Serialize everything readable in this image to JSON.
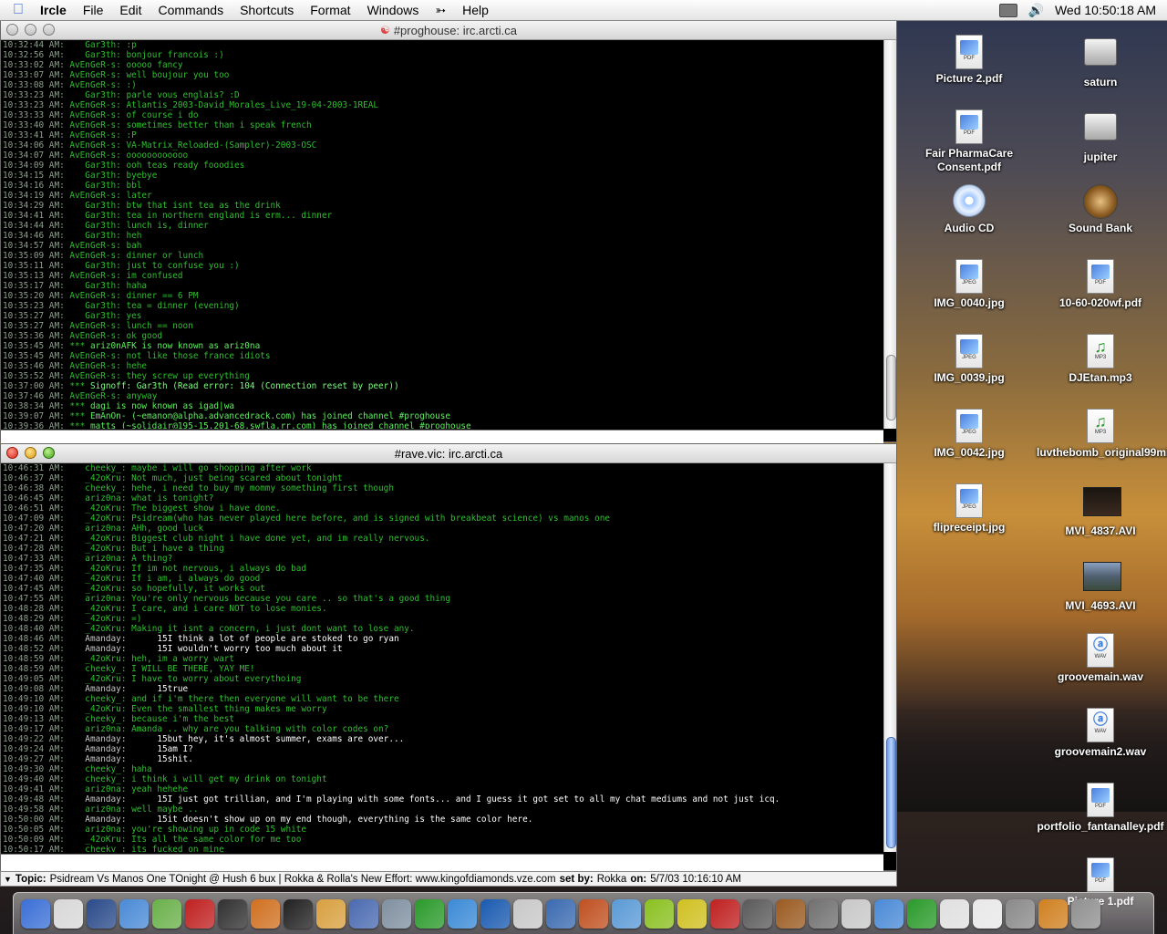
{
  "menubar": {
    "app": "Ircle",
    "items": [
      "File",
      "Edit",
      "Commands",
      "Shortcuts",
      "Format",
      "Windows",
      "Help"
    ],
    "clock": "Wed 10:50:18 AM"
  },
  "win1": {
    "title": "#proghouse: irc.arcti.ca",
    "lines": [
      {
        "t": "10:32:44 AM:",
        "n": "   Gar3th:",
        "m": " :p"
      },
      {
        "t": "10:32:56 AM:",
        "n": "   Gar3th:",
        "m": " bonjour francois :)"
      },
      {
        "t": "10:33:02 AM:",
        "n": "AvEnGeR-s:",
        "m": " ooooo fancy"
      },
      {
        "t": "10:33:07 AM:",
        "n": "AvEnGeR-s:",
        "m": " well boujour you too"
      },
      {
        "t": "10:33:08 AM:",
        "n": "AvEnGeR-s:",
        "m": " :)"
      },
      {
        "t": "10:33:23 AM:",
        "n": "   Gar3th:",
        "m": " parle vous englais? :D"
      },
      {
        "t": "10:33:23 AM:",
        "n": "AvEnGeR-s:",
        "m": " Atlantis_2003-David_Morales_Live_19-04-2003-1REAL"
      },
      {
        "t": "10:33:33 AM:",
        "n": "AvEnGeR-s:",
        "m": " of course i do"
      },
      {
        "t": "10:33:40 AM:",
        "n": "AvEnGeR-s:",
        "m": " sometimes better than i speak french"
      },
      {
        "t": "10:33:41 AM:",
        "n": "AvEnGeR-s:",
        "m": " :P"
      },
      {
        "t": "10:34:06 AM:",
        "n": "AvEnGeR-s:",
        "m": " VA-Matrix_Reloaded-(Sampler)-2003-OSC"
      },
      {
        "t": "10:34:07 AM:",
        "n": "AvEnGeR-s:",
        "m": " oooooooooooo"
      },
      {
        "t": "10:34:09 AM:",
        "n": "   Gar3th:",
        "m": " ooh teas ready fooodies"
      },
      {
        "t": "10:34:15 AM:",
        "n": "   Gar3th:",
        "m": " byebye"
      },
      {
        "t": "10:34:16 AM:",
        "n": "   Gar3th:",
        "m": " bbl"
      },
      {
        "t": "10:34:19 AM:",
        "n": "AvEnGeR-s:",
        "m": " later"
      },
      {
        "t": "10:34:29 AM:",
        "n": "   Gar3th:",
        "m": " btw that isnt tea as the drink"
      },
      {
        "t": "10:34:41 AM:",
        "n": "   Gar3th:",
        "m": " tea in northern england is erm... dinner"
      },
      {
        "t": "10:34:44 AM:",
        "n": "   Gar3th:",
        "m": " lunch is, dinner"
      },
      {
        "t": "10:34:46 AM:",
        "n": "   Gar3th:",
        "m": " heh"
      },
      {
        "t": "10:34:57 AM:",
        "n": "AvEnGeR-s:",
        "m": " bah"
      },
      {
        "t": "10:35:09 AM:",
        "n": "AvEnGeR-s:",
        "m": " dinner or lunch"
      },
      {
        "t": "10:35:11 AM:",
        "n": "   Gar3th:",
        "m": " just to confuse you :)"
      },
      {
        "t": "10:35:13 AM:",
        "n": "AvEnGeR-s:",
        "m": " im confused"
      },
      {
        "t": "10:35:17 AM:",
        "n": "   Gar3th:",
        "m": " haha"
      },
      {
        "t": "10:35:20 AM:",
        "n": "AvEnGeR-s:",
        "m": " dinner == 6 PM"
      },
      {
        "t": "10:35:23 AM:",
        "n": "   Gar3th:",
        "m": " tea = dinner (evening)"
      },
      {
        "t": "10:35:27 AM:",
        "n": "   Gar3th:",
        "m": " yes"
      },
      {
        "t": "10:35:27 AM:",
        "n": "AvEnGeR-s:",
        "m": " lunch == noon"
      },
      {
        "t": "10:35:36 AM:",
        "n": "AvEnGeR-s:",
        "m": " ok good"
      },
      {
        "t": "10:35:45 AM:",
        "n": "***",
        "m": " ariz0nAFK is now known as ariz0na",
        "k": "sys"
      },
      {
        "t": "10:35:45 AM:",
        "n": "AvEnGeR-s:",
        "m": " not like those france idiots"
      },
      {
        "t": "10:35:46 AM:",
        "n": "AvEnGeR-s:",
        "m": " hehe"
      },
      {
        "t": "10:35:52 AM:",
        "n": "AvEnGeR-s:",
        "m": " they screw up everything"
      },
      {
        "t": "10:37:00 AM:",
        "n": "***",
        "m": " Signoff: Gar3th (Read error: 104 (Connection reset by peer))",
        "k": "err"
      },
      {
        "t": "10:37:46 AM:",
        "n": "AvEnGeR-s:",
        "m": " anyway"
      },
      {
        "t": "10:38:34 AM:",
        "n": "***",
        "m": " dagi is now known as igad|wa",
        "k": "sys"
      },
      {
        "t": "10:39:07 AM:",
        "n": "***",
        "m": " EmAnOn- (~emanon@alpha.advancedrack.com) has joined channel #proghouse",
        "k": "sys"
      },
      {
        "t": "10:39:36 AM:",
        "n": "***",
        "m": " matts (~solidair@195-15.201-68.swfla.rr.com) has joined channel #proghouse",
        "k": "sys"
      }
    ]
  },
  "win2": {
    "title": "#rave.vic: irc.arcti.ca",
    "lines": [
      {
        "t": "10:46:31 AM:",
        "n": "   cheeky_:",
        "m": " maybe i will go shopping after work"
      },
      {
        "t": "10:46:37 AM:",
        "n": "   _42oKru:",
        "m": " Not much, just being scared about tonight"
      },
      {
        "t": "10:46:38 AM:",
        "n": "   cheeky_:",
        "m": " hehe, i need to buy my mommy something first though"
      },
      {
        "t": "10:46:45 AM:",
        "n": "   ariz0na:",
        "m": " what is tonight?"
      },
      {
        "t": "10:46:51 AM:",
        "n": "   _42oKru:",
        "m": " The biggest show i have done."
      },
      {
        "t": "10:47:09 AM:",
        "n": "   _42oKru:",
        "m": " Psidream(who has never played here before, and is signed with breakbeat science) vs manos one"
      },
      {
        "t": "10:47:20 AM:",
        "n": "   ariz0na:",
        "m": " AHh, good luck"
      },
      {
        "t": "10:47:21 AM:",
        "n": "   _42oKru:",
        "m": " Biggest club night i have done yet, and im really nervous."
      },
      {
        "t": "10:47:28 AM:",
        "n": "   _42oKru:",
        "m": " But i have a thing"
      },
      {
        "t": "10:47:33 AM:",
        "n": "   ariz0na:",
        "m": " A thing?"
      },
      {
        "t": "10:47:35 AM:",
        "n": "   _42oKru:",
        "m": " If im not nervous, i always do bad"
      },
      {
        "t": "10:47:40 AM:",
        "n": "   _42oKru:",
        "m": " If i am, i always do good"
      },
      {
        "t": "10:47:45 AM:",
        "n": "   _42oKru:",
        "m": " so hopefully, it works out"
      },
      {
        "t": "10:47:55 AM:",
        "n": "   ariz0na:",
        "m": " You're only nervous because you care .. so that's a good thing"
      },
      {
        "t": "10:48:28 AM:",
        "n": "   _42oKru:",
        "m": " I care, and i care NOT to lose monies."
      },
      {
        "t": "10:48:29 AM:",
        "n": "   _42oKru:",
        "m": " =)"
      },
      {
        "t": "10:48:40 AM:",
        "n": "   _42oKru:",
        "m": " Making it isnt a concern, i just dont want to lose any."
      },
      {
        "t": "10:48:46 AM:",
        "n": "   Amanday:",
        "m": "      15I think a lot of people are stoked to go ryan",
        "k": "me"
      },
      {
        "t": "10:48:52 AM:",
        "n": "   Amanday:",
        "m": "      15I wouldn't worry too much about it",
        "k": "me"
      },
      {
        "t": "10:48:59 AM:",
        "n": "   _42oKru:",
        "m": " heh, im a worry wart"
      },
      {
        "t": "10:48:59 AM:",
        "n": "   cheeky_:",
        "m": " I WILL BE THERE, YAY ME!"
      },
      {
        "t": "10:49:05 AM:",
        "n": "   _42oKru:",
        "m": " I have to worry about everythoing"
      },
      {
        "t": "10:49:08 AM:",
        "n": "   Amanday:",
        "m": "      15true",
        "k": "me"
      },
      {
        "t": "10:49:10 AM:",
        "n": "   cheeky_:",
        "m": " and if i'm there then everyone will want to be there"
      },
      {
        "t": "10:49:10 AM:",
        "n": "   _42oKru:",
        "m": " Even the smallest thing makes me worry"
      },
      {
        "t": "10:49:13 AM:",
        "n": "   cheeky_:",
        "m": " because i'm the best"
      },
      {
        "t": "10:49:17 AM:",
        "n": "   ariz0na:",
        "m": " Amanda .. why are you talking with color codes on?"
      },
      {
        "t": "10:49:22 AM:",
        "n": "   Amanday:",
        "m": "      15but hey, it's almost summer, exams are over...",
        "k": "me"
      },
      {
        "t": "10:49:24 AM:",
        "n": "   Amanday:",
        "m": "      15am I?",
        "k": "me"
      },
      {
        "t": "10:49:27 AM:",
        "n": "   Amanday:",
        "m": "      15shit.",
        "k": "me"
      },
      {
        "t": "10:49:30 AM:",
        "n": "   cheeky_:",
        "m": " haha"
      },
      {
        "t": "10:49:40 AM:",
        "n": "   cheeky_:",
        "m": " i think i will get my drink on tonight"
      },
      {
        "t": "10:49:41 AM:",
        "n": "   ariz0na:",
        "m": " yeah hehehe"
      },
      {
        "t": "10:49:48 AM:",
        "n": "   Amanday:",
        "m": "      15I just got trillian, and I'm playing with some fonts... and I guess it got set to all my chat mediums and not just icq.",
        "k": "me"
      },
      {
        "t": "10:49:58 AM:",
        "n": "   ariz0na:",
        "m": " well maybe .."
      },
      {
        "t": "10:50:00 AM:",
        "n": "   Amanday:",
        "m": "      15it doesn't show up on my end though, everything is the same color here.",
        "k": "me"
      },
      {
        "t": "10:50:05 AM:",
        "n": "   ariz0na:",
        "m": " you're showing up in code 15 white"
      },
      {
        "t": "10:50:09 AM:",
        "n": "   _42oKru:",
        "m": " Its all the same color for me too"
      },
      {
        "t": "10:50:17 AM:",
        "n": "   cheeky_:",
        "m": " its fucked on mine"
      }
    ]
  },
  "topic": {
    "label": "Topic:",
    "text": "Psidream Vs Manos One TOnight @ Hush 6 bux | Rokka & Rolla's New Effort: www.kingofdiamonds.vze.com",
    "setby_label": "set by:",
    "setby": "Rokka",
    "on_label": "on:",
    "on": "5/7/03 10:16:10 AM"
  },
  "desktop_icons": [
    {
      "label": "Picture 2.pdf",
      "kind": "doc",
      "tag": "PDF"
    },
    {
      "label": "saturn",
      "kind": "disk"
    },
    {
      "label": "Fair PharmaCare Consent.pdf",
      "kind": "doc",
      "tag": "PDF"
    },
    {
      "label": "jupiter",
      "kind": "disk"
    },
    {
      "label": "Audio CD",
      "kind": "cd"
    },
    {
      "label": "Sound Bank",
      "kind": "bank"
    },
    {
      "label": "IMG_0040.jpg",
      "kind": "doc",
      "tag": "JPEG"
    },
    {
      "label": "10-60-020wf.pdf",
      "kind": "doc",
      "tag": "PDF"
    },
    {
      "label": "IMG_0039.jpg",
      "kind": "doc",
      "tag": "JPEG"
    },
    {
      "label": "DJEtan.mp3",
      "kind": "mp3",
      "tag": "MP3"
    },
    {
      "label": "IMG_0042.jpg",
      "kind": "doc",
      "tag": "JPEG"
    },
    {
      "label": "luvthebomb_original99mix.mp3",
      "kind": "mp3",
      "tag": "MP3"
    },
    {
      "label": "flipreceipt.jpg",
      "kind": "doc",
      "tag": "JPEG"
    },
    {
      "label": "MVI_4837.AVI",
      "kind": "movie"
    },
    {
      "label": "MVI_4693.AVI",
      "kind": "movie2"
    },
    {
      "label": "groovemain.wav",
      "kind": "wav",
      "tag": "WAV"
    },
    {
      "label": "groovemain2.wav",
      "kind": "wav",
      "tag": "WAV"
    },
    {
      "label": "portfolio_fantanalley.pdf",
      "kind": "doc",
      "tag": "PDF"
    },
    {
      "label": "Picture 1.pdf",
      "kind": "doc",
      "tag": "PDF"
    }
  ],
  "dock_colors": [
    "#3a6fd6",
    "#d8d8d8",
    "#2a4a8a",
    "#4a8ad6",
    "#6ab04a",
    "#c02020",
    "#303030",
    "#d07020",
    "#202020",
    "#d8a040",
    "#4a6ab0",
    "#8090a0",
    "#2a9a2a",
    "#3a8ad6",
    "#1a5ab0",
    "#c8c8c8",
    "#3a6ab0",
    "#c05020",
    "#5a9ad6",
    "#8ac020",
    "#d0c020",
    "#c02020",
    "#5a5a5a",
    "#9a5a20",
    "#707070",
    "#c8c8c8",
    "#4a8ad6",
    "#2a9a2a",
    "#e0e0e0",
    "#e8e8e8",
    "#8a8a8a",
    "#d08020",
    "#909090"
  ]
}
